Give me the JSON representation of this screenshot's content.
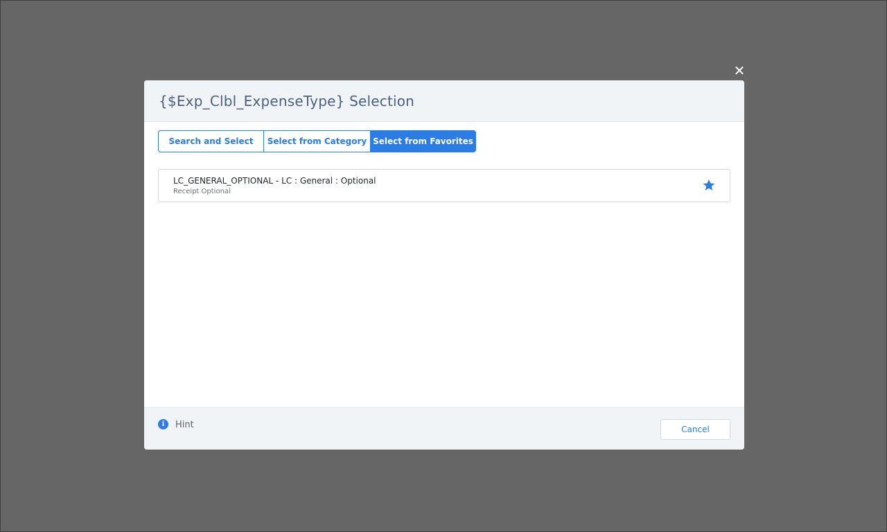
{
  "dialog": {
    "title": "{$Exp_Clbl_ExpenseType} Selection",
    "close_icon": "close-icon"
  },
  "tabs": [
    {
      "label": "Search and Select",
      "active": false
    },
    {
      "label": "Select from Category",
      "active": false
    },
    {
      "label": "Select from Favorites",
      "active": true
    }
  ],
  "favorites": [
    {
      "title": "LC_GENERAL_OPTIONAL - LC : General : Optional",
      "subtitle": "Receipt Optional",
      "favorited": true,
      "icon": "star-icon"
    }
  ],
  "footer": {
    "hint_icon": "info-icon",
    "hint_label": "Hint",
    "cancel_label": "Cancel"
  },
  "colors": {
    "accent": "#2b7ce5",
    "overlay": "#666666",
    "header_bg": "#f1f4f7",
    "title_text": "#4a5f7d"
  }
}
